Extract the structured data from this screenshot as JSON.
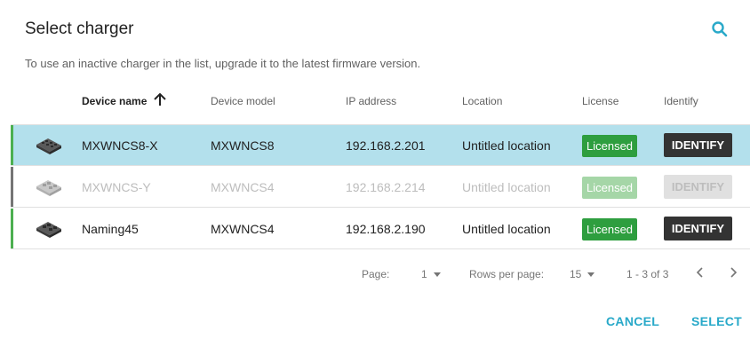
{
  "dialog": {
    "title": "Select charger",
    "subtitle": "To use an inactive charger in the list, upgrade it to the latest firmware version.",
    "search_icon": "search-icon",
    "accent_color": "#29a9c9"
  },
  "table": {
    "columns": {
      "device_name": "Device name",
      "device_model": "Device model",
      "ip_address": "IP address",
      "location": "Location",
      "license": "License",
      "identify": "Identify"
    },
    "sort": {
      "column": "device_name",
      "direction": "ascending",
      "icon": "arrow-up-icon"
    },
    "rows": [
      {
        "name": "MXWNCS8-X",
        "model": "MXWNCS8",
        "ip": "192.168.2.201",
        "location": "Untitled location",
        "license": "Licensed",
        "identify": "IDENTIFY",
        "status": "active",
        "selected": true,
        "stripe_color": "#4caf50"
      },
      {
        "name": "MXWNCS-Y",
        "model": "MXWNCS4",
        "ip": "192.168.2.214",
        "location": "Untitled location",
        "license": "Licensed",
        "identify": "IDENTIFY",
        "status": "inactive",
        "selected": false,
        "stripe_color": "#757575"
      },
      {
        "name": "Naming45",
        "model": "MXWNCS4",
        "ip": "192.168.2.190",
        "location": "Untitled location",
        "license": "Licensed",
        "identify": "IDENTIFY",
        "status": "active",
        "selected": false,
        "stripe_color": "#4caf50"
      }
    ]
  },
  "pagination": {
    "page_label": "Page:",
    "page_value": "1",
    "rows_per_page_label": "Rows per page:",
    "rows_per_page_value": "15",
    "range": "1 - 3 of 3",
    "prev_icon": "chevron-left-icon",
    "next_icon": "chevron-right-icon"
  },
  "footer": {
    "cancel": "CANCEL",
    "select": "SELECT"
  }
}
